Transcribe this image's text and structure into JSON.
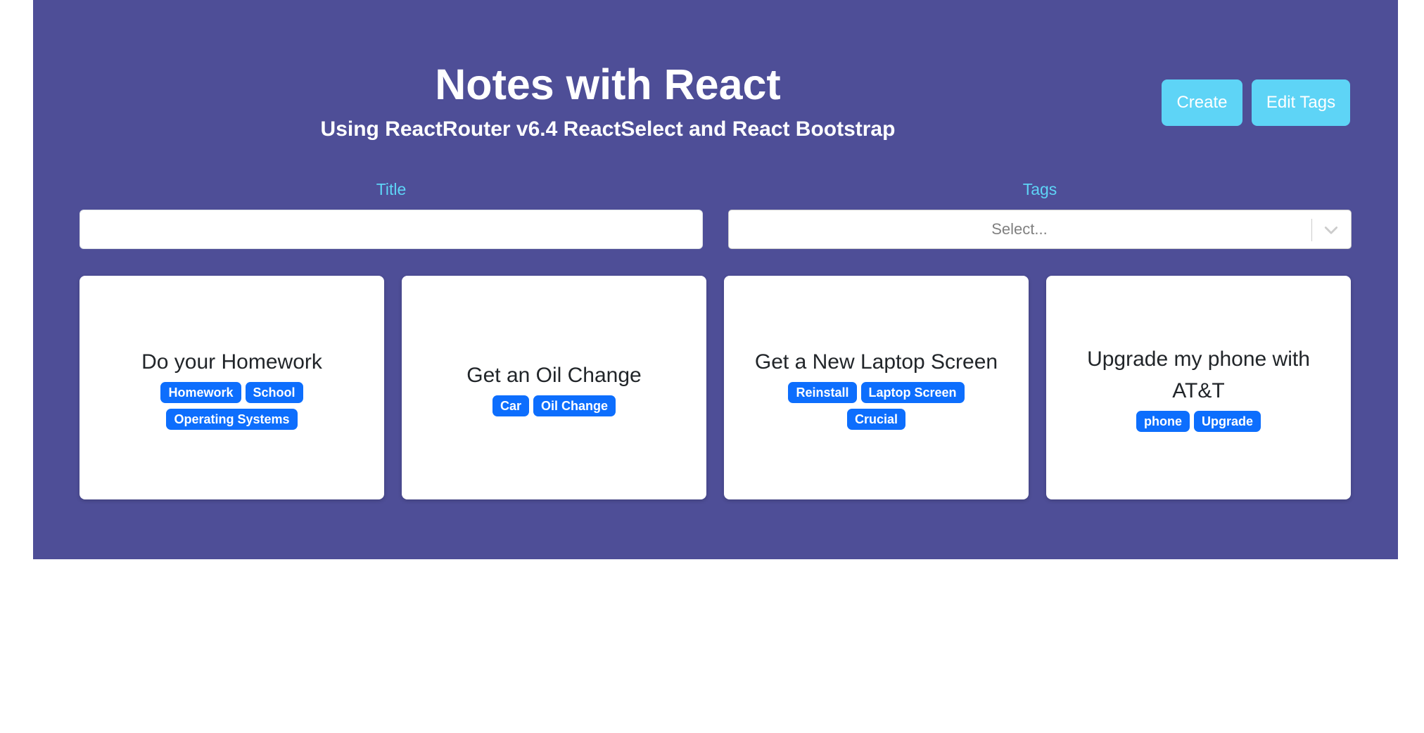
{
  "header": {
    "title": "Notes with React",
    "subtitle": "Using ReactRouter v6.4 ReactSelect and React Bootstrap",
    "create_label": "Create",
    "edit_tags_label": "Edit Tags"
  },
  "filters": {
    "title_label": "Title",
    "title_value": "",
    "tags_label": "Tags",
    "tags_placeholder": "Select..."
  },
  "notes": [
    {
      "title": "Do your Homework",
      "tags": [
        "Homework",
        "School",
        "Operating Systems"
      ]
    },
    {
      "title": "Get an Oil Change",
      "tags": [
        "Car",
        "Oil Change"
      ]
    },
    {
      "title": "Get a New Laptop Screen",
      "tags": [
        "Reinstall",
        "Laptop Screen",
        "Crucial"
      ]
    },
    {
      "title": "Upgrade my phone with AT&T",
      "tags": [
        "phone",
        "Upgrade"
      ]
    }
  ],
  "colors": {
    "background": "#4e4e97",
    "accent": "#5ed4f6",
    "badge": "#0d6efd"
  },
  "icons": {
    "select_indicator": "chevron-down-icon"
  }
}
